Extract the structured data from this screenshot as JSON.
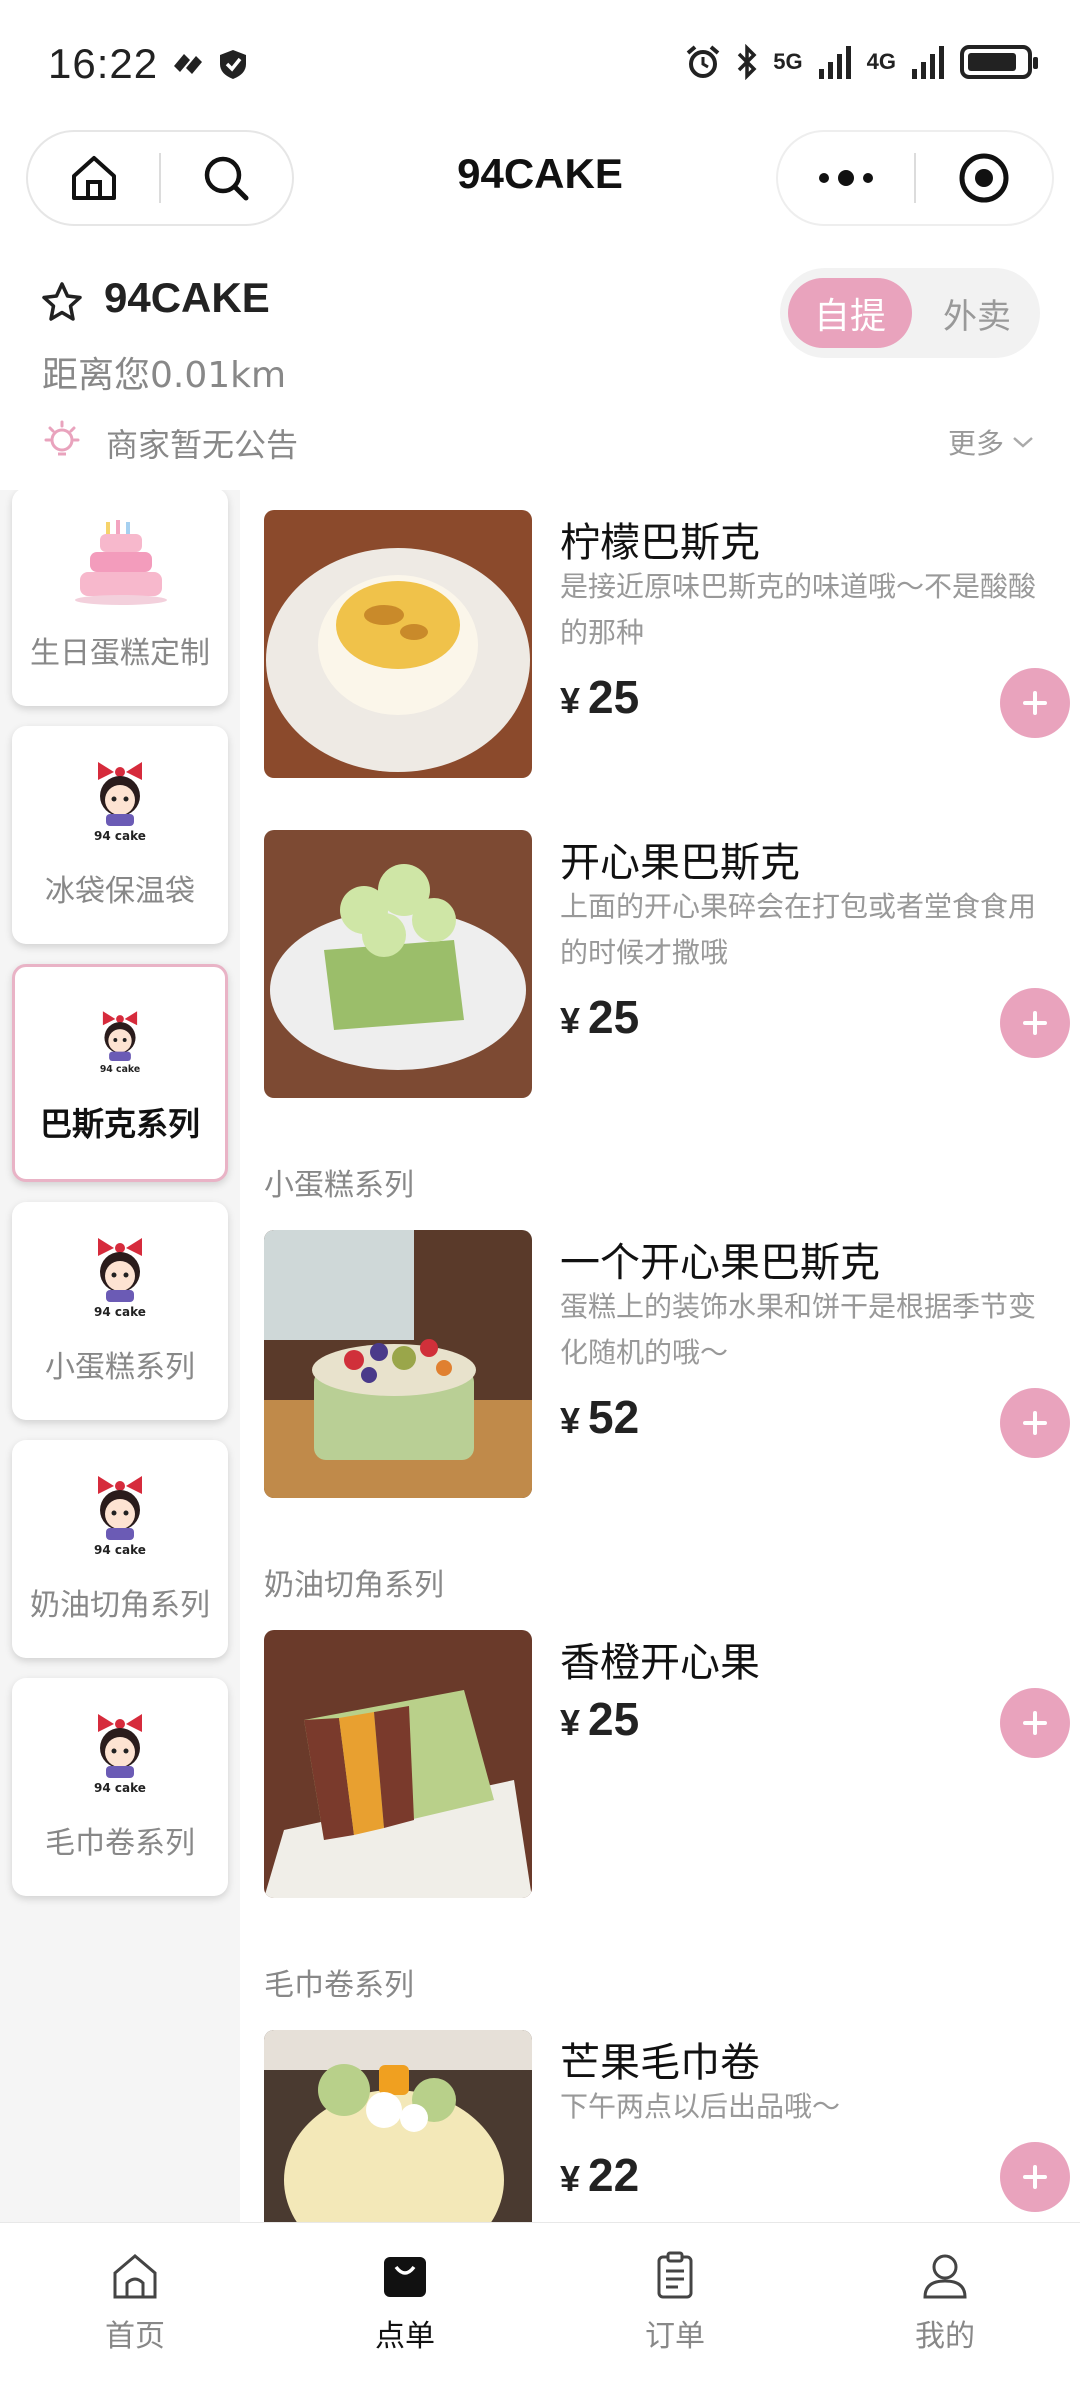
{
  "status_bar": {
    "time": "16:22",
    "network_5g": "5G",
    "network_4g": "4G"
  },
  "nav": {
    "title": "94CAKE"
  },
  "store": {
    "name": "94CAKE",
    "distance": "距离您0.01km",
    "mode_pickup": "自提",
    "mode_delivery": "外卖",
    "notice": "商家暂无公告",
    "notice_more": "更多"
  },
  "categories": [
    {
      "label": "生日蛋糕定制",
      "icon": "birthday-cake-icon",
      "active": false
    },
    {
      "label": "冰袋保温袋",
      "icon": "mascot-logo-icon",
      "active": false
    },
    {
      "label": "巴斯克系列",
      "icon": "mascot-logo-icon",
      "active": true
    },
    {
      "label": "小蛋糕系列",
      "icon": "mascot-logo-icon",
      "active": false
    },
    {
      "label": "奶油切角系列",
      "icon": "mascot-logo-icon",
      "active": false
    },
    {
      "label": "毛巾卷系列",
      "icon": "mascot-logo-icon",
      "active": false
    }
  ],
  "logo_text": "94 cake",
  "sections": {
    "small_cakes": "小蛋糕系列",
    "cream_slices": "奶油切角系列",
    "towel_rolls": "毛巾卷系列"
  },
  "products": [
    {
      "name": "柠檬巴斯克",
      "desc": "是接近原味巴斯克的味道哦～不是酸酸的那种",
      "currency": "¥",
      "price": "25"
    },
    {
      "name": "开心果巴斯克",
      "desc": "上面的开心果碎会在打包或者堂食食用的时候才撒哦",
      "currency": "¥",
      "price": "25"
    },
    {
      "name": "一个开心果巴斯克",
      "desc": "蛋糕上的装饰水果和饼干是根据季节变化随机的哦～",
      "currency": "¥",
      "price": "52"
    },
    {
      "name": "香橙开心果",
      "desc": "",
      "currency": "¥",
      "price": "25"
    },
    {
      "name": "芒果毛巾卷",
      "desc": "下午两点以后出品哦～",
      "currency": "¥",
      "price": "22"
    }
  ],
  "tabbar": {
    "home": "首页",
    "order": "点单",
    "orders": "订单",
    "mine": "我的"
  },
  "colors": {
    "accent_pink": "#e9a3bd",
    "text_dark": "#111111",
    "text_grey": "#888888"
  }
}
